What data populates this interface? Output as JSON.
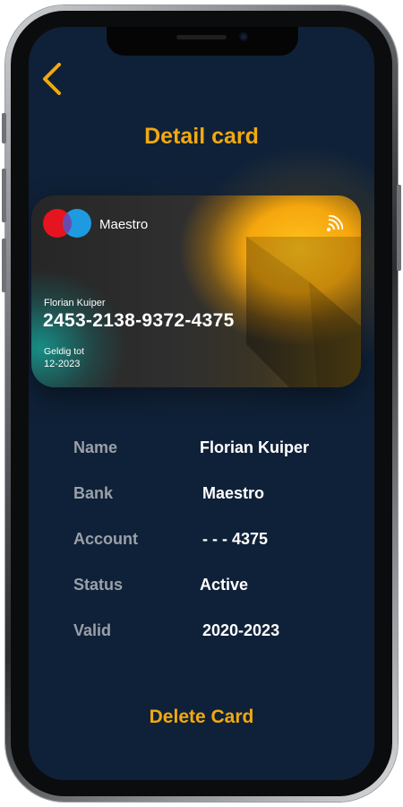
{
  "header": {
    "title": "Detail card",
    "back_icon": "chevron-left-icon"
  },
  "card": {
    "brand": "Maestro",
    "holder": "Florian Kuiper",
    "number": "2453-2138-9372-4375",
    "valid_label": "Geldig tot",
    "valid_date": "12-2023",
    "contactless_icon": "nfc-icon",
    "logo_icon": "mastercard-logo-icon"
  },
  "details": [
    {
      "label": "Name",
      "value": "Florian Kuiper"
    },
    {
      "label": "Bank",
      "value": "Maestro"
    },
    {
      "label": "Account",
      "value": "- - - 4375"
    },
    {
      "label": "Status",
      "value": "Active"
    },
    {
      "label": "Valid",
      "value": "2020-2023"
    }
  ],
  "actions": {
    "delete_label": "Delete Card"
  },
  "colors": {
    "accent": "#f2a90f",
    "background": "#0f2138",
    "label": "#9aa0a8",
    "value": "#ffffff"
  }
}
